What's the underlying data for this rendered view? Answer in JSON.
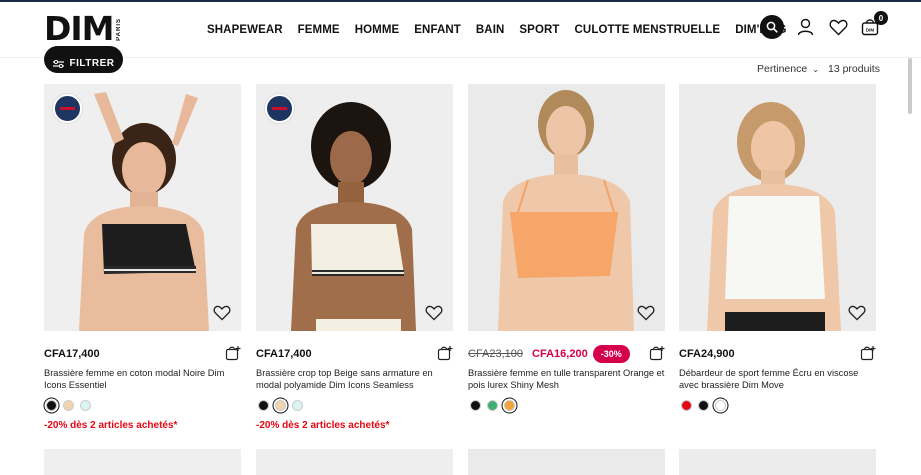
{
  "brand": {
    "logo": "DIM",
    "logo_sub": "PARIS"
  },
  "nav": {
    "items": [
      "SHAPEWEAR",
      "FEMME",
      "HOMME",
      "ENFANT",
      "BAIN",
      "SPORT",
      "CULOTTE MENSTRUELLE",
      "DIM'MAG"
    ]
  },
  "header": {
    "cart_count": "0"
  },
  "toolbar": {
    "filter_label": "FILTRER",
    "sort_label": "Pertinence",
    "count_label": "13 produits"
  },
  "products": [
    {
      "price": "CFA17,400",
      "name": "Brassière femme en coton modal Noire Dim Icons Essentiel",
      "swatches": [
        "#111111",
        "#f0d4b0",
        "#d9f5f2"
      ],
      "promo": "-20% dès 2 articles achetés*"
    },
    {
      "price": "CFA17,400",
      "name": "Brassière crop top Beige sans armature en modal polyamide Dim Icons Seamless",
      "swatches": [
        "#111111",
        "#f0d4b0",
        "#d9f5f2"
      ],
      "promo": "-20% dès 2 articles achetés*"
    },
    {
      "price_old": "CFA23,100",
      "price_new": "CFA16,200",
      "discount": "-30%",
      "name": "Brassière femme en tulle transparent Orange et pois lurex Shiny Mesh",
      "swatches": [
        "#111111",
        "#3fae72",
        "#f2a33a"
      ]
    },
    {
      "price": "CFA24,900",
      "name": "Débardeur de sport femme Écru en viscose avec brassière Dim Move",
      "swatches": [
        "#e30613",
        "#111111",
        "#ffffff"
      ]
    }
  ],
  "colors": {
    "accent": "#d4004c",
    "promo": "#e30613",
    "dark": "#111111"
  }
}
